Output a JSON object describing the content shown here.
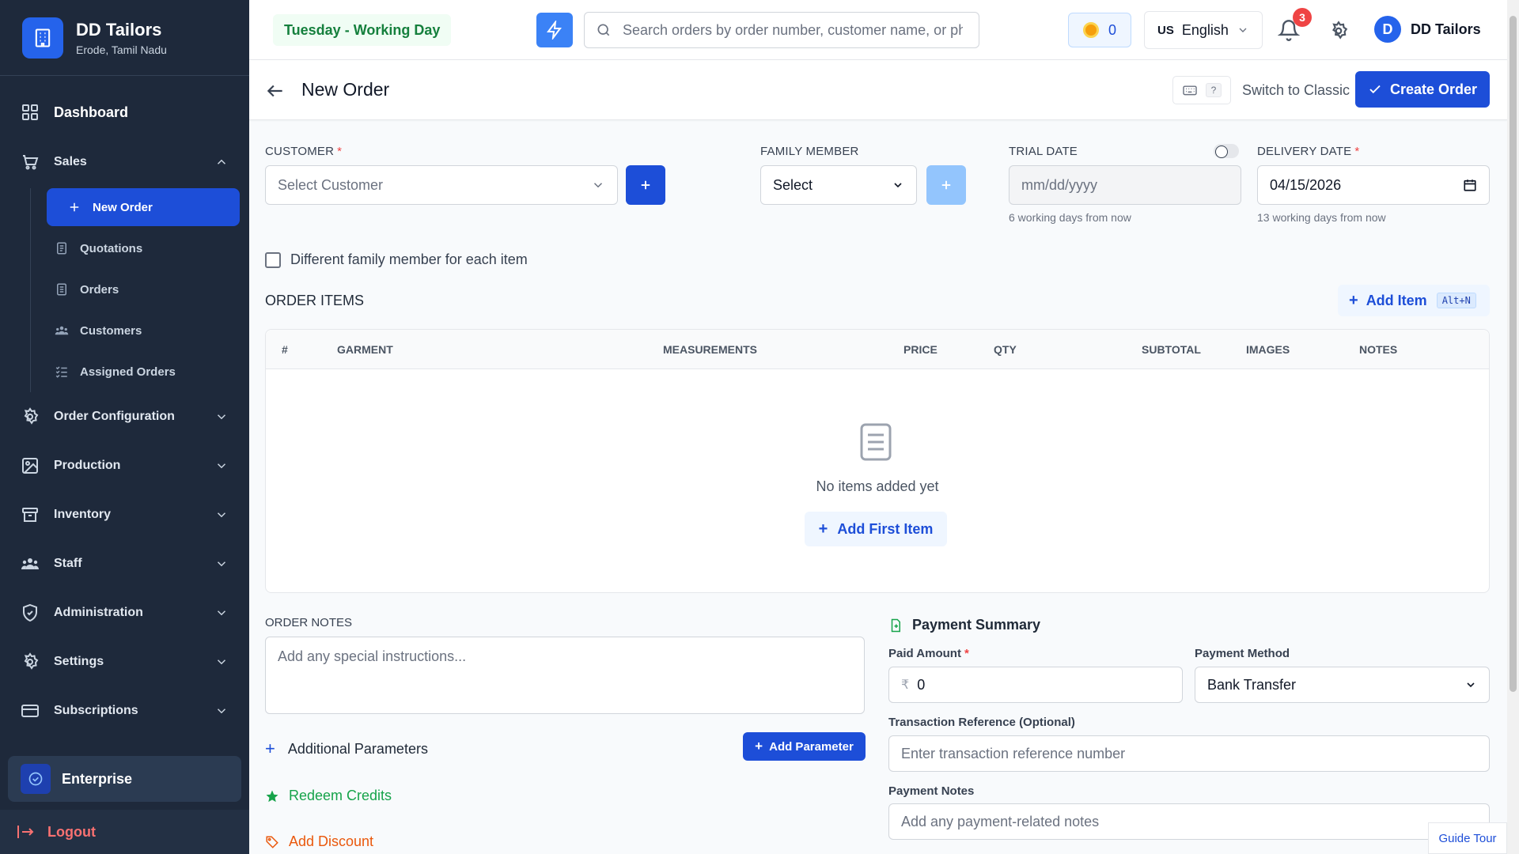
{
  "brand": {
    "name": "DD Tailors",
    "location": "Erode, Tamil Nadu"
  },
  "sidebar": {
    "dashboard": "Dashboard",
    "sales": "Sales",
    "sales_items": [
      {
        "label": "New Order",
        "icon": "plus-icon"
      },
      {
        "label": "Quotations",
        "icon": "document-icon"
      },
      {
        "label": "Orders",
        "icon": "list-icon"
      },
      {
        "label": "Customers",
        "icon": "users-icon"
      },
      {
        "label": "Assigned Orders",
        "icon": "checklist-icon"
      }
    ],
    "sections": [
      "Order Configuration",
      "Production",
      "Inventory",
      "Staff",
      "Administration",
      "Settings",
      "Subscriptions"
    ],
    "plan": "Enterprise",
    "logout": "Logout"
  },
  "topbar": {
    "day_status": "Tuesday - Working Day",
    "search_placeholder": "Search orders by order number, customer name, or phone",
    "coins": "0",
    "lang_flag": "US",
    "language": "English",
    "notifications": "3",
    "user_initial": "D",
    "user_name": "DD Tailors"
  },
  "header": {
    "title": "New Order",
    "shortcut_key": "?",
    "switch_label": "Switch to Classic",
    "create_label": "Create Order"
  },
  "form": {
    "customer_label": "CUSTOMER",
    "customer_placeholder": "Select Customer",
    "family_label": "FAMILY MEMBER",
    "family_value": "Select",
    "trial_label": "TRIAL DATE",
    "trial_placeholder": "mm/dd/yyyy",
    "trial_hint": "6 working days from now",
    "delivery_label": "DELIVERY DATE",
    "delivery_value": "04/15/2026",
    "delivery_hint": "13 working days from now",
    "different_member": "Different family member for each item",
    "required_mark": "*"
  },
  "items": {
    "title": "ORDER ITEMS",
    "add_label": "Add Item",
    "add_shortcut": "Alt+N",
    "columns": [
      "#",
      "GARMENT",
      "MEASUREMENTS",
      "PRICE",
      "QTY",
      "SUBTOTAL",
      "IMAGES",
      "NOTES"
    ],
    "empty_text": "No items added yet",
    "add_first": "Add First Item"
  },
  "notes": {
    "label": "ORDER NOTES",
    "placeholder": "Add any special instructions...",
    "additional_params": "Additional Parameters",
    "add_param_button": "Add Parameter",
    "redeem": "Redeem Credits",
    "discount": "Add Discount"
  },
  "payment": {
    "title": "Payment Summary",
    "paid_label": "Paid Amount",
    "currency": "₹",
    "paid_value": "0",
    "method_label": "Payment Method",
    "method_value": "Bank Transfer",
    "txn_label": "Transaction Reference (Optional)",
    "txn_placeholder": "Enter transaction reference number",
    "notes_label": "Payment Notes",
    "notes_placeholder": "Add any payment-related notes"
  },
  "guide_tour": "Guide Tour"
}
